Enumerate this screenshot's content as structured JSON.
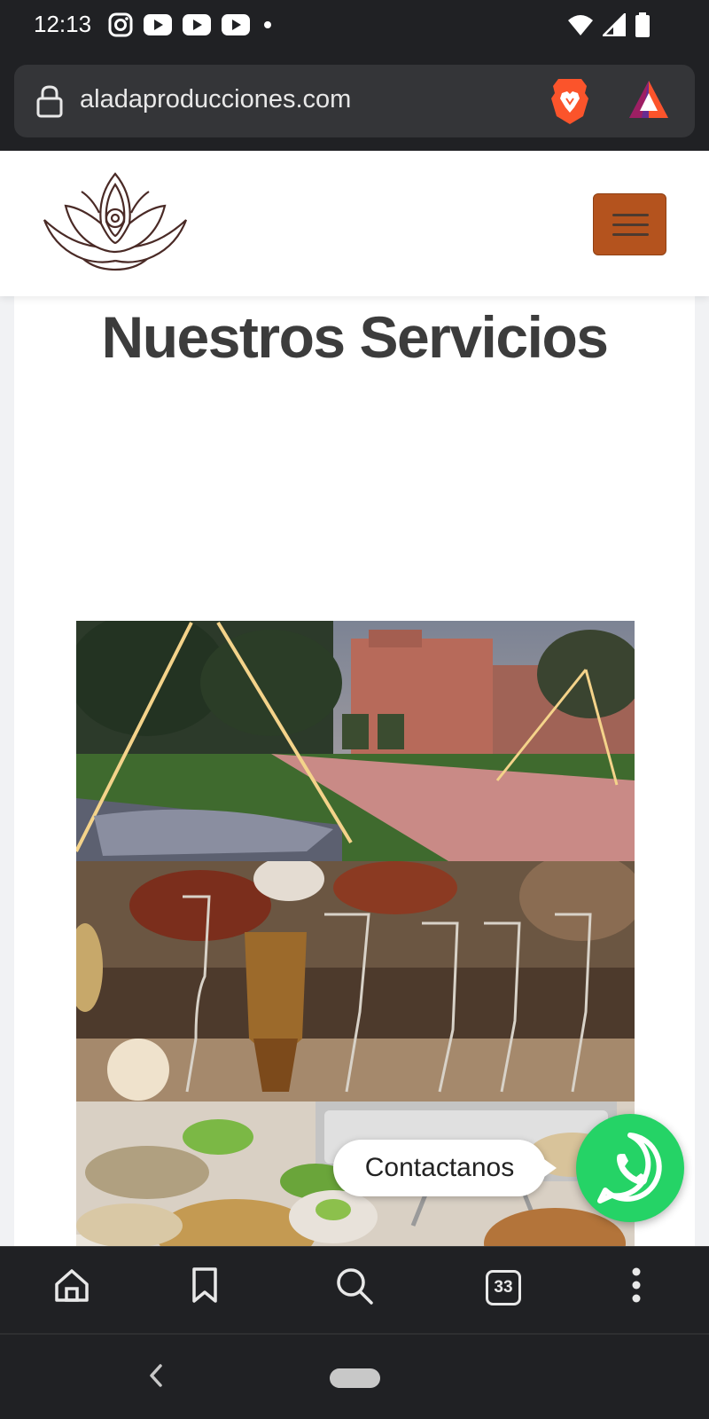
{
  "status_bar": {
    "time": "12:13",
    "left_icons": [
      "instagram-icon",
      "youtube-icon",
      "youtube-icon",
      "youtube-icon",
      "dot-icon"
    ],
    "right_icons": [
      "wifi-icon",
      "signal-icon",
      "battery-icon"
    ]
  },
  "browser": {
    "url": "aladaproducciones.com",
    "tab_count": "33",
    "toolbar_icons": [
      "home-icon",
      "bookmark-icon",
      "search-icon",
      "tabs-icon",
      "more-icon"
    ],
    "brave_color": "#fb542b"
  },
  "site": {
    "logo": "lotus-logo",
    "menu_button_color": "#b4531e",
    "section_title": "Nuestros Servicios",
    "service_images": [
      "outdoor-event-lights-photo",
      "glassware-table-photo",
      "catering-buffet-photo"
    ]
  },
  "whatsapp": {
    "label": "Contactanos",
    "color": "#25d366"
  }
}
